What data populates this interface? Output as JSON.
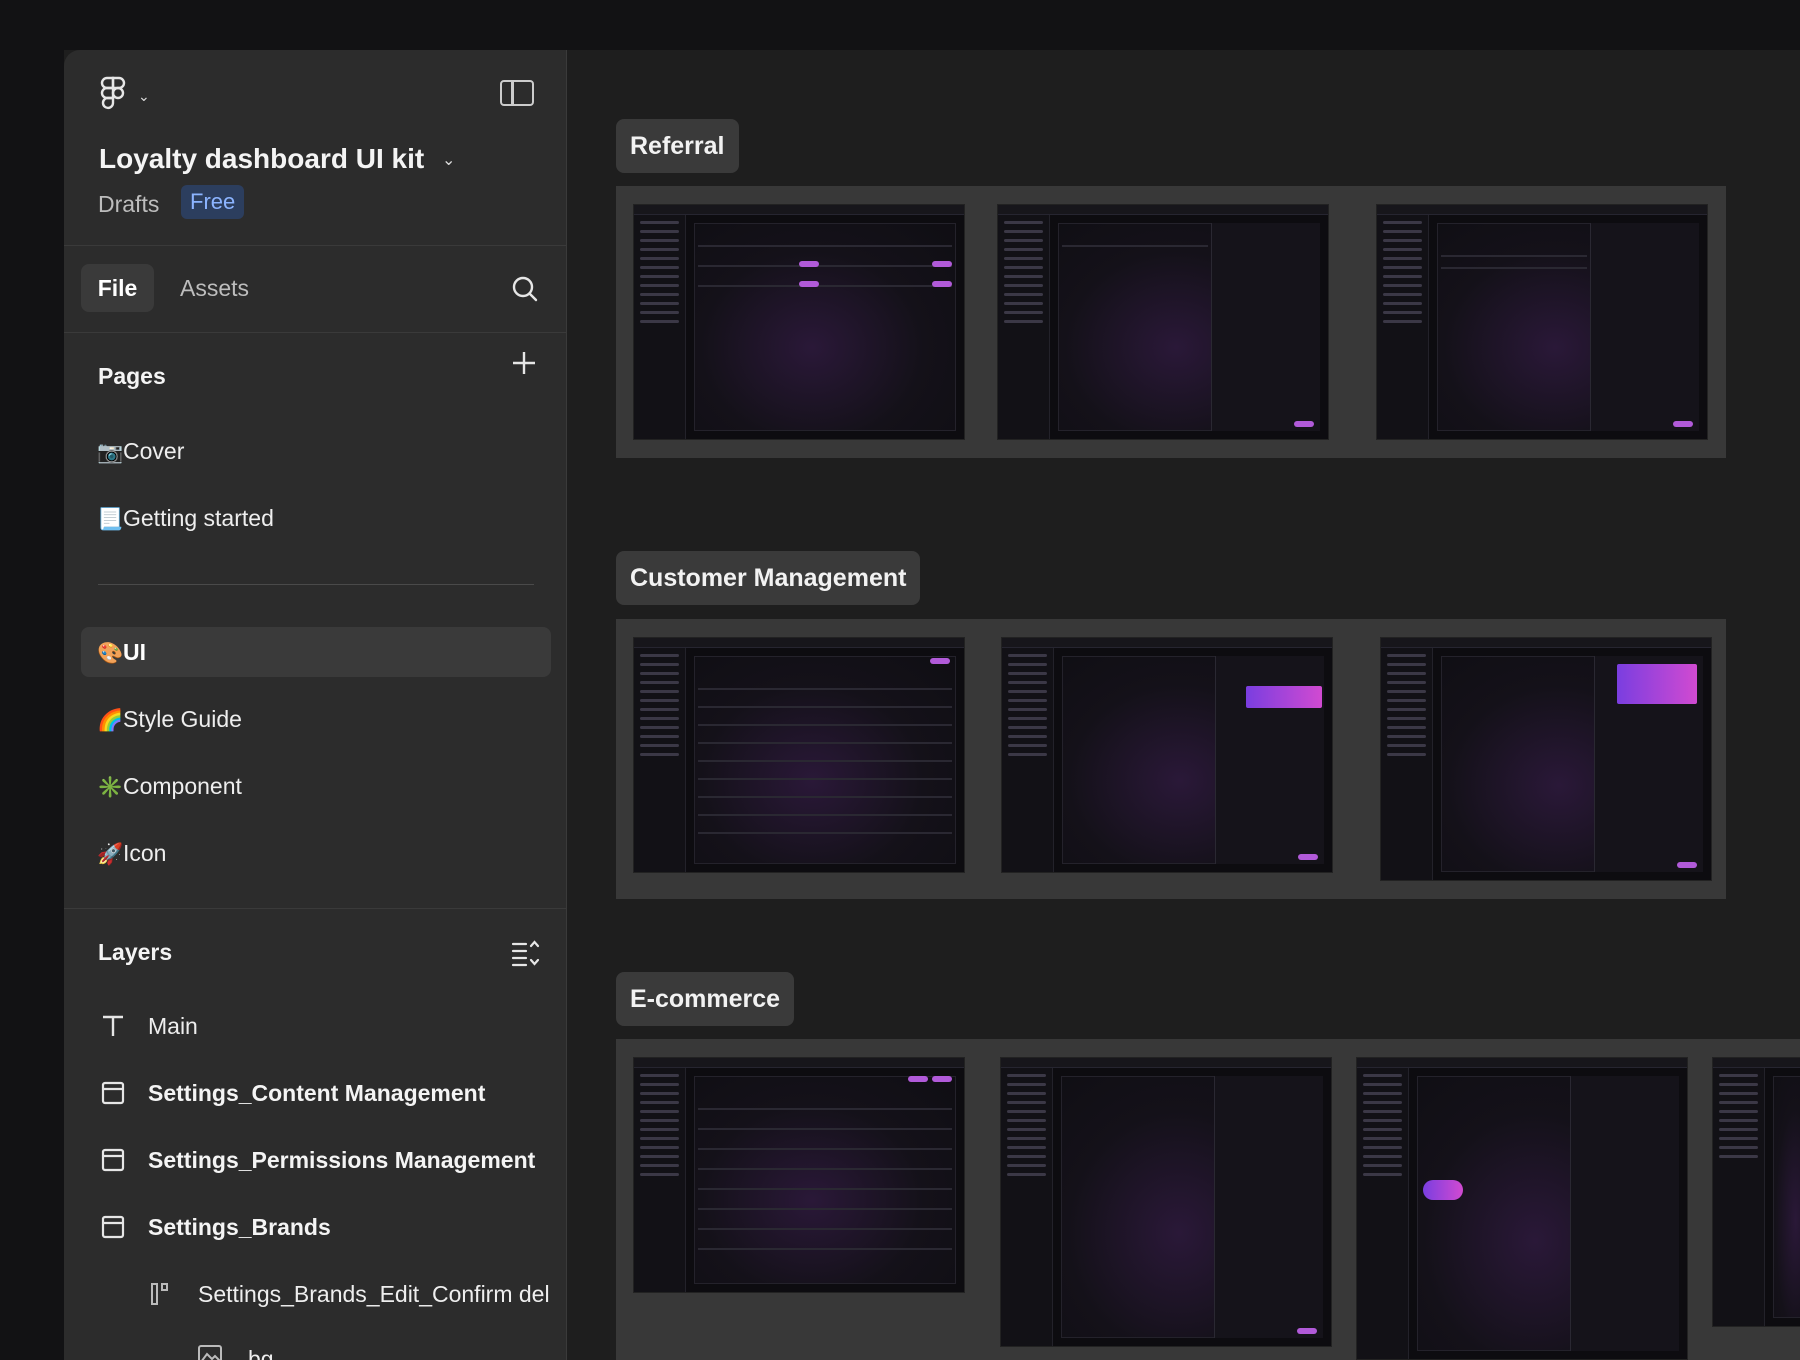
{
  "file": {
    "title": "Loyalty dashboard UI kit",
    "location": "Drafts",
    "plan_badge": "Free"
  },
  "tabs": {
    "file": "File",
    "assets": "Assets"
  },
  "pages": {
    "heading": "Pages",
    "items": [
      {
        "emoji": "📷",
        "label": "Cover"
      },
      {
        "emoji": "📃",
        "label": "Getting started"
      },
      {
        "emoji": "🎨",
        "label": "UI"
      },
      {
        "emoji": "🌈",
        "label": "Style Guide"
      },
      {
        "emoji": "✳️",
        "label": "Component"
      },
      {
        "emoji": "🚀",
        "label": "Icon"
      }
    ],
    "active": "UI"
  },
  "layers": {
    "heading": "Layers",
    "items": [
      {
        "icon": "text-icon",
        "label": "Main"
      },
      {
        "icon": "frame-icon",
        "label": "Settings_Content Management"
      },
      {
        "icon": "frame-icon",
        "label": "Settings_Permissions Management"
      },
      {
        "icon": "frame-icon",
        "label": "Settings_Brands"
      },
      {
        "icon": "component-icon",
        "label": "Settings_Brands_Edit_Confirm del"
      },
      {
        "icon": "image-icon",
        "label": "bg"
      }
    ]
  },
  "canvas": {
    "sections": [
      {
        "label": "Referral"
      },
      {
        "label": "Customer Management"
      },
      {
        "label": "E-commerce"
      }
    ]
  },
  "colors": {
    "sidebar_bg": "#2c2c2c",
    "canvas_bg": "#1e1e1e",
    "accent_purple": "#b15ad9",
    "badge_blue": "#8cb4ff"
  }
}
